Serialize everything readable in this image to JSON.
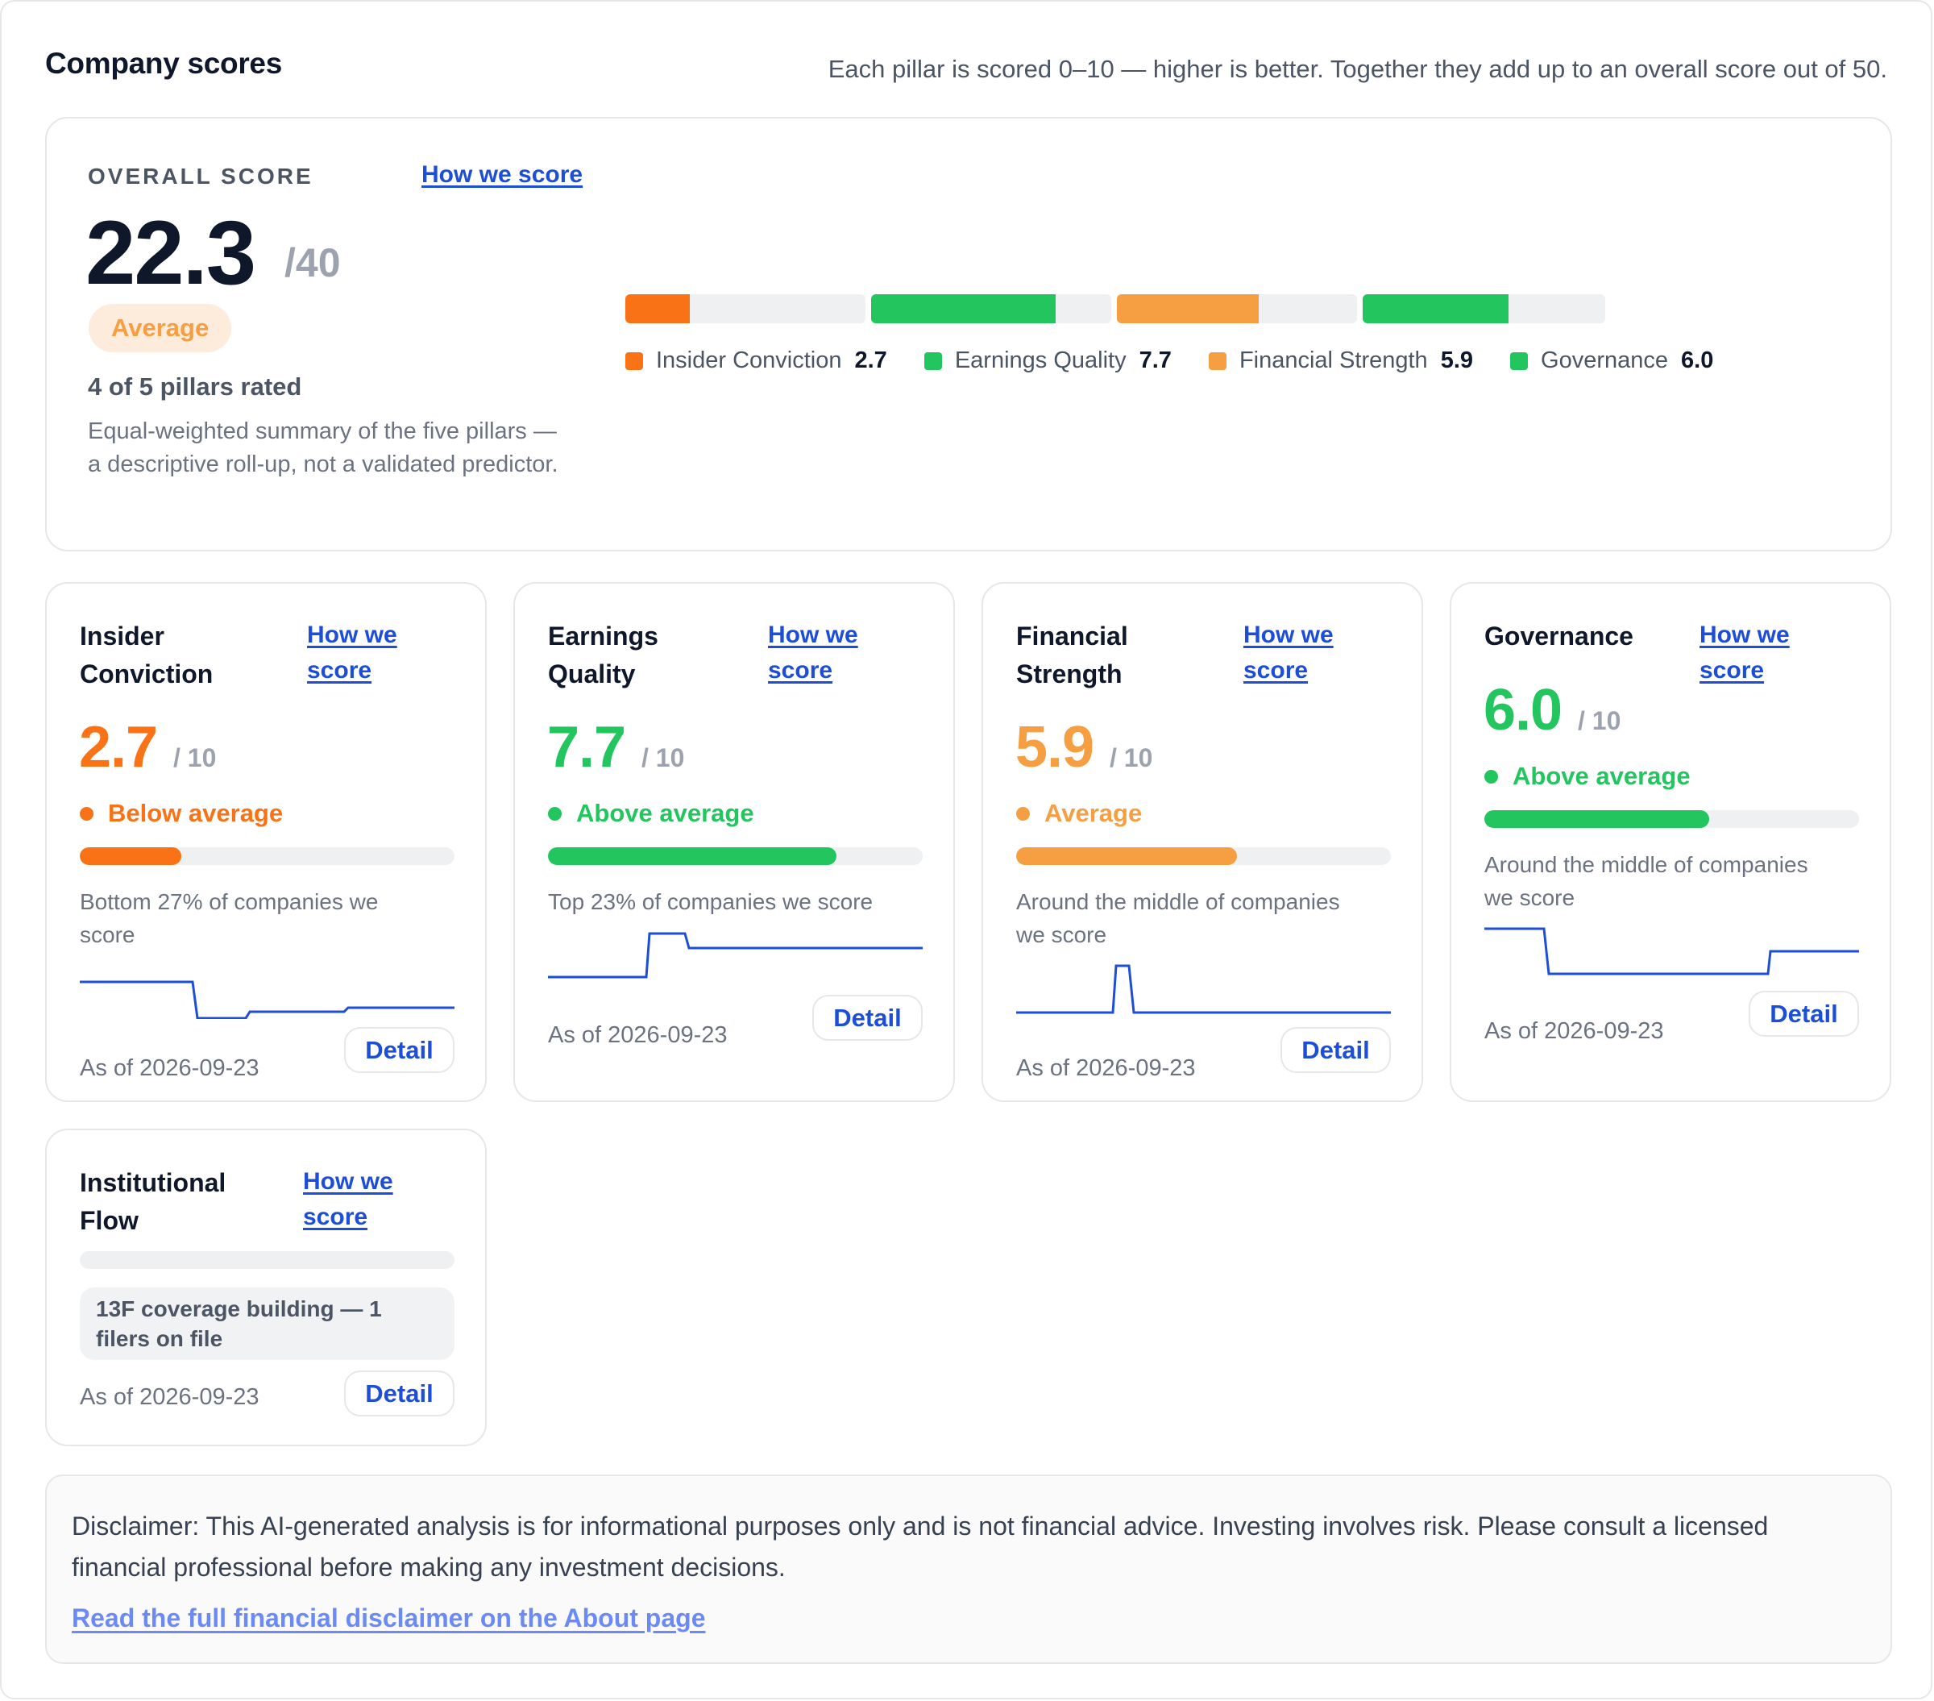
{
  "header": {
    "title": "Company scores",
    "subtitle": "Each pillar is scored 0–10 — higher is better. Together they add up to an overall score out of 50."
  },
  "overall": {
    "label": "OVERALL SCORE",
    "how_link": "How we score",
    "value": "22.3",
    "max": "/40",
    "badge": "Average",
    "rated": "4 of 5 pillars rated",
    "note": "Equal-weighted summary of the five pillars — a descriptive roll-up, not a validated predictor.",
    "segments": [
      {
        "name": "Insider Conviction",
        "value": "2.7",
        "fraction": 0.27,
        "color": "#f97316"
      },
      {
        "name": "Earnings Quality",
        "value": "7.7",
        "fraction": 0.77,
        "color": "#22c55e"
      },
      {
        "name": "Financial Strength",
        "value": "5.9",
        "fraction": 0.59,
        "color": "#f59e42"
      },
      {
        "name": "Governance",
        "value": "6.0",
        "fraction": 0.6,
        "color": "#22c55e"
      }
    ]
  },
  "pillars": [
    {
      "title": "Insider Conviction",
      "how_link": "How we score",
      "score": "2.7",
      "max": "/ 10",
      "rating": "Below average",
      "color": "#f97316",
      "fraction": 0.27,
      "desc": "Bottom 27% of companies we score",
      "date": "As of 2026-09-23",
      "detail": "Detail"
    },
    {
      "title": "Earnings Quality",
      "how_link": "How we score",
      "score": "7.7",
      "max": "/ 10",
      "rating": "Above average",
      "color": "#22c55e",
      "fraction": 0.77,
      "desc": "Top 23% of companies we score",
      "date": "As of 2026-09-23",
      "detail": "Detail"
    },
    {
      "title": "Financial Strength",
      "how_link": "How we score",
      "score": "5.9",
      "max": "/ 10",
      "rating": "Average",
      "color": "#f59e42",
      "fraction": 0.59,
      "desc": "Around the middle of companies we score",
      "date": "As of 2026-09-23",
      "detail": "Detail"
    },
    {
      "title": "Governance",
      "how_link": "How we score",
      "score": "6.0",
      "max": "/ 10",
      "rating": "Above average",
      "color": "#22c55e",
      "fraction": 0.6,
      "desc": "Around the middle of companies we score",
      "date": "As of 2026-09-23",
      "detail": "Detail"
    },
    {
      "title": "Institutional Flow",
      "how_link": "How we score",
      "coverage": "13F coverage building — 1 filers on file",
      "date": "As of 2026-09-23",
      "detail": "Detail"
    }
  ],
  "disclaimer": {
    "text": "Disclaimer: This AI-generated analysis is for informational purposes only and is not financial advice. Investing involves risk. Please consult a licensed financial professional before making any investment decisions.",
    "link": "Read the full financial disclaimer on the About page"
  }
}
